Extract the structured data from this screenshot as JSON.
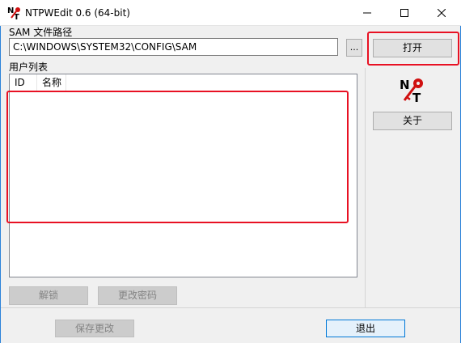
{
  "window": {
    "title": "NTPWEdit 0.6 (64-bit)",
    "minimize_glyph": "—",
    "maximize_glyph": "☐",
    "close_glyph": "✕",
    "app_icon": "ntpwedit-icon",
    "app_icon_text": "N T"
  },
  "sam": {
    "label": "SAM 文件路径",
    "path": "C:\\WINDOWS\\SYSTEM32\\CONFIG\\SAM",
    "browse_label": "..."
  },
  "sidebar": {
    "open_label": "打开",
    "logo_icon": "ntpwedit-key-logo",
    "about_label": "关于"
  },
  "user_list": {
    "label": "用户列表",
    "columns": [
      "ID",
      "名称"
    ],
    "rows": []
  },
  "actions": {
    "unlock_label": "解锁",
    "change_password_label": "更改密码",
    "save_label": "保存更改",
    "exit_label": "退出"
  },
  "colors": {
    "highlight": "#e81123",
    "frame_accent": "#2b82d9",
    "logo_red": "#d01010"
  }
}
